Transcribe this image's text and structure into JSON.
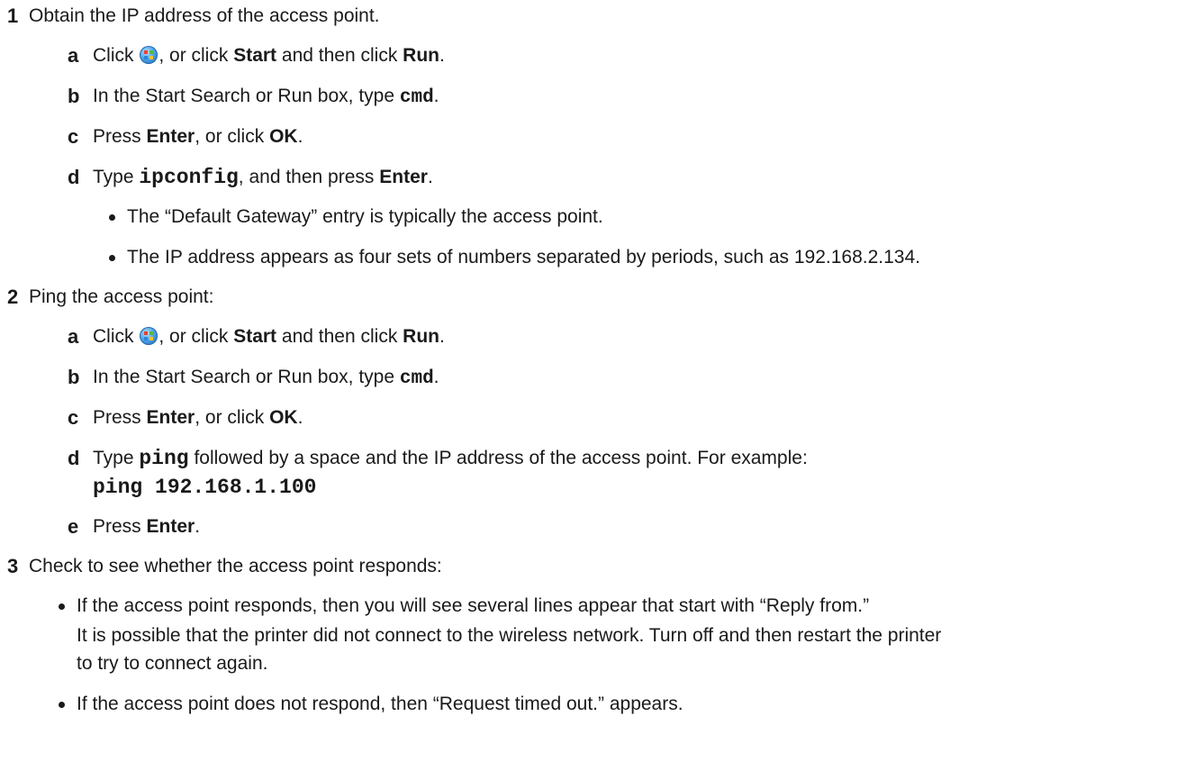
{
  "step1": {
    "num": "1",
    "title": "Obtain the IP address of the access point.",
    "a": {
      "letter": "a",
      "click": "Click",
      "mid": ", or click",
      "start": "Start",
      "and": "and then click",
      "run": "Run",
      "end": "."
    },
    "b": {
      "letter": "b",
      "text": "In the Start Search or Run box, type",
      "cmd": "cmd",
      "end": "."
    },
    "c": {
      "letter": "c",
      "press": "Press",
      "enter": "Enter",
      "mid": ", or click",
      "ok": "OK",
      "end": "."
    },
    "d": {
      "letter": "d",
      "type": "Type",
      "cmd": "ipconfig",
      "mid": ", and then press",
      "enter": "Enter",
      "end": "."
    },
    "bullets": [
      "The “Default Gateway” entry is typically the access point.",
      "The IP address appears as four sets of numbers separated by periods, such as 192.168.2.134."
    ]
  },
  "step2": {
    "num": "2",
    "title": "Ping the access point:",
    "a": {
      "letter": "a",
      "click": "Click",
      "mid": ", or click",
      "start": "Start",
      "and": "and then click",
      "run": "Run",
      "end": "."
    },
    "b": {
      "letter": "b",
      "text": "In the Start Search or Run box, type",
      "cmd": "cmd",
      "end": "."
    },
    "c": {
      "letter": "c",
      "press": "Press",
      "enter": "Enter",
      "mid": ", or click",
      "ok": "OK",
      "end": "."
    },
    "d": {
      "letter": "d",
      "type": "Type",
      "cmd": "ping",
      "rest": "followed by a space and the IP address of the access point. For example:",
      "example": "ping 192.168.1.100"
    },
    "e": {
      "letter": "e",
      "press": "Press",
      "enter": "Enter",
      "end": "."
    }
  },
  "step3": {
    "num": "3",
    "title": "Check to see whether the access point responds:",
    "bullet1": "If the access point responds, then you will see several lines appear that start with “Reply from.”",
    "para1": "It is possible that the printer did not connect to the wireless network. Turn off and then restart the printer",
    "para2": "to try to connect again.",
    "bullet2": "If the access point does not respond, then “Request timed out.” appears."
  },
  "icons": {
    "start_orb": "windows-start-orb-icon"
  }
}
